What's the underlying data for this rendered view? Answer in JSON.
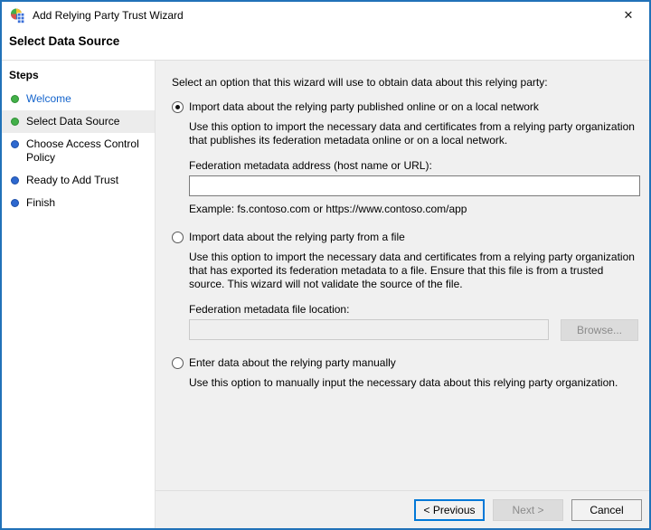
{
  "colors": {
    "accent": "#2172b8",
    "focus": "#0078d7",
    "link": "#1464cc",
    "bullet-done": "#43b049",
    "bullet-done-border": "#2f8f35",
    "bullet-todo": "#2d68cf",
    "bullet-todo-border": "#1d4fa8",
    "content-bg": "#f0f0f0"
  },
  "window": {
    "title": "Add Relying Party Trust Wizard",
    "close_glyph": "✕"
  },
  "page": {
    "title": "Select Data Source"
  },
  "sidebar": {
    "title": "Steps",
    "items": [
      {
        "label": "Welcome",
        "state": "done",
        "current": false
      },
      {
        "label": "Select Data Source",
        "state": "done",
        "current": true
      },
      {
        "label": "Choose Access Control Policy",
        "state": "todo",
        "current": false
      },
      {
        "label": "Ready to Add Trust",
        "state": "todo",
        "current": false
      },
      {
        "label": "Finish",
        "state": "todo",
        "current": false
      }
    ]
  },
  "main": {
    "intro": "Select an option that this wizard will use to obtain data about this relying party:",
    "options": [
      {
        "label": "Import data about the relying party published online or on a local network",
        "selected": true,
        "description": "Use this option to import the necessary data and certificates from a relying party organization that publishes its federation metadata online or on a local network.",
        "field_label": "Federation metadata address (host name or URL):",
        "input_value": "",
        "input_enabled": true,
        "example": "Example: fs.contoso.com or https://www.contoso.com/app"
      },
      {
        "label": "Import data about the relying party from a file",
        "selected": false,
        "description": "Use this option to import the necessary data and certificates from a relying party organization that has exported its federation metadata to a file. Ensure that this file is from a trusted source.  This wizard will not validate the source of the file.",
        "field_label": "Federation metadata file location:",
        "input_value": "",
        "input_enabled": false,
        "browse_label": "Browse..."
      },
      {
        "label": "Enter data about the relying party manually",
        "selected": false,
        "description": "Use this option to manually input the necessary data about this relying party organization."
      }
    ]
  },
  "footer": {
    "previous_label": "< Previous",
    "next_label": "Next >",
    "next_enabled": false,
    "cancel_label": "Cancel"
  }
}
